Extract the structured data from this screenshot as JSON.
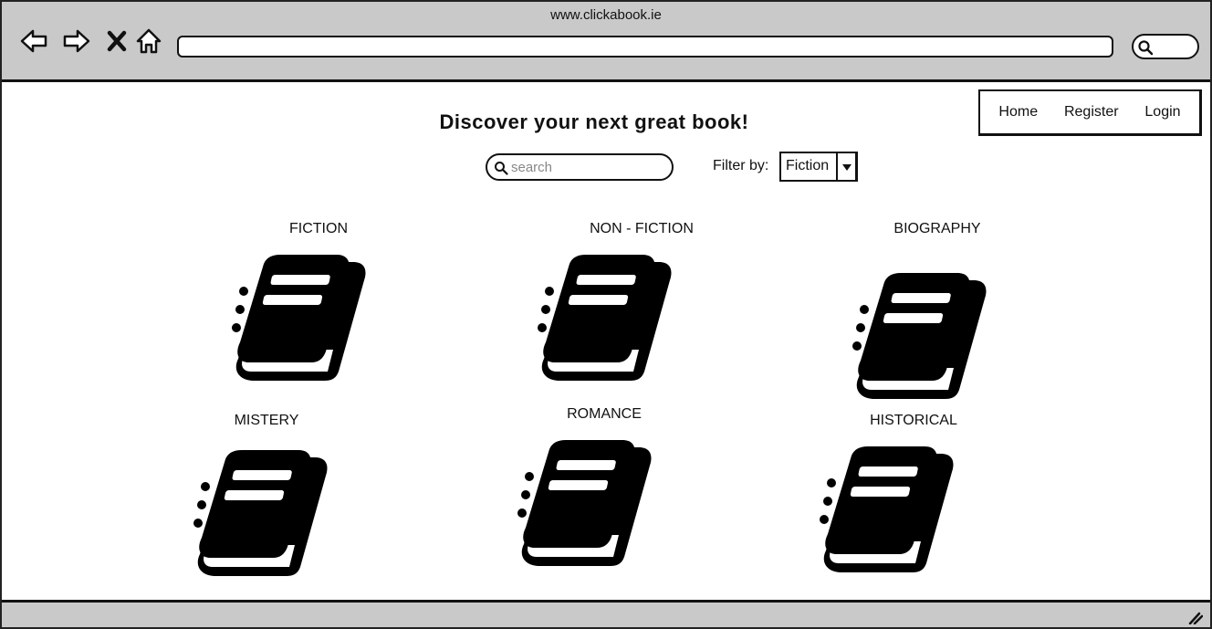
{
  "browser": {
    "url_title": "www.clickabook.ie",
    "icons": [
      "back-arrow-icon",
      "forward-arrow-icon",
      "close-icon",
      "home-icon",
      "search-icon"
    ]
  },
  "nav": {
    "home": "Home",
    "register": "Register",
    "login": "Login"
  },
  "main": {
    "headline": "Discover your next great book!",
    "search_placeholder": "search",
    "filter_label": "Filter by:",
    "filter_value": "Fiction"
  },
  "categories": [
    {
      "label": "FICTION",
      "icon": "book-icon"
    },
    {
      "label": "NON - FICTION",
      "icon": "book-icon"
    },
    {
      "label": "BIOGRAPHY",
      "icon": "book-icon"
    },
    {
      "label": "MISTERY",
      "icon": "book-icon"
    },
    {
      "label": "ROMANCE",
      "icon": "book-icon"
    },
    {
      "label": "HISTORICAL",
      "icon": "book-icon"
    }
  ]
}
